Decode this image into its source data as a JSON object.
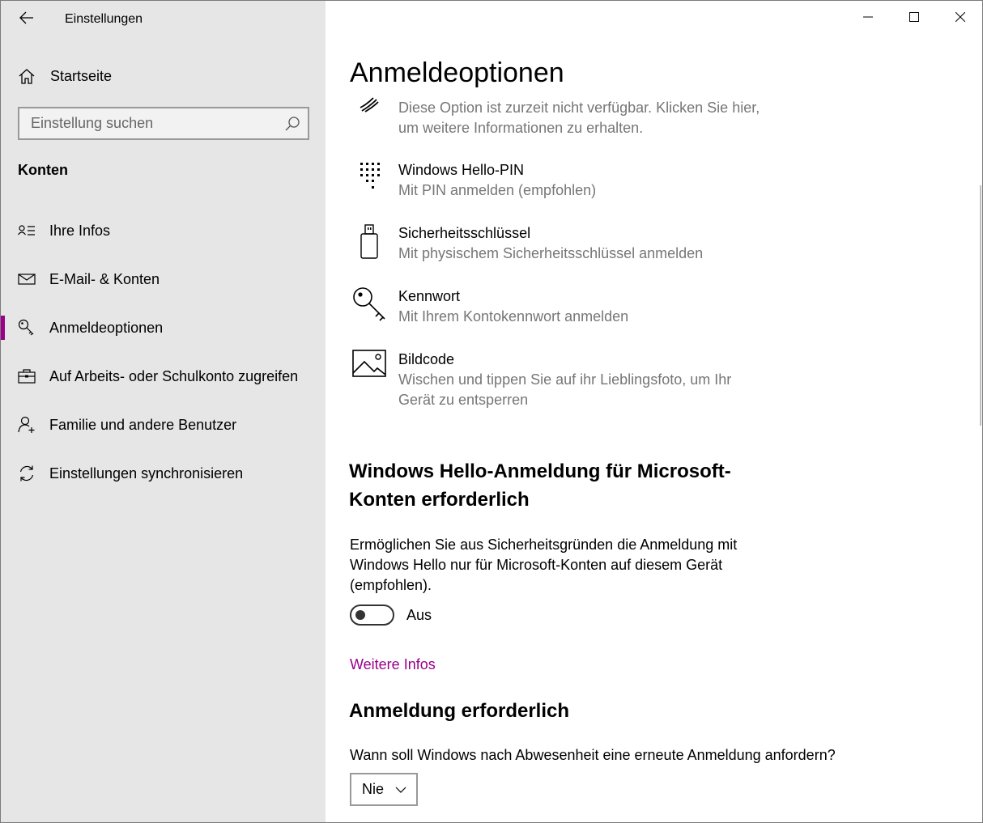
{
  "app": {
    "title": "Einstellungen"
  },
  "sidebar": {
    "home_label": "Startseite",
    "search_placeholder": "Einstellung suchen",
    "section_label": "Konten",
    "items": [
      {
        "label": "Ihre Infos",
        "icon": "person-card-icon",
        "active": false
      },
      {
        "label": "E-Mail- & Konten",
        "icon": "mail-icon",
        "active": false
      },
      {
        "label": "Anmeldeoptionen",
        "icon": "key-icon",
        "active": true
      },
      {
        "label": "Auf Arbeits- oder Schulkonto zugreifen",
        "icon": "briefcase-icon",
        "active": false
      },
      {
        "label": "Familie und andere Benutzer",
        "icon": "person-add-icon",
        "active": false
      },
      {
        "label": "Einstellungen synchronisieren",
        "icon": "sync-icon",
        "active": false
      }
    ],
    "accent_color": "#9a0089"
  },
  "main": {
    "title": "Anmeldeoptionen",
    "options": [
      {
        "title": "",
        "desc": "Diese Option ist zurzeit nicht verfügbar. Klicken Sie hier,\num weitere Informationen zu erhalten.",
        "icon": "fingerprint-icon"
      },
      {
        "title": "Windows Hello-PIN",
        "desc": "Mit PIN anmelden (empfohlen)",
        "icon": "pin-keypad-icon"
      },
      {
        "title": "Sicherheitsschlüssel",
        "desc": "Mit physischem Sicherheitsschlüssel anmelden",
        "icon": "usb-key-icon"
      },
      {
        "title": "Kennwort",
        "desc": "Mit Ihrem Kontokennwort anmelden",
        "icon": "key-icon"
      },
      {
        "title": "Bildcode",
        "desc": "Wischen und tippen Sie auf ihr Lieblingsfoto, um Ihr\nGerät zu entsperren",
        "icon": "picture-icon"
      }
    ],
    "hello_section": {
      "heading": "Windows Hello-Anmeldung für Microsoft-\nKonten erforderlich",
      "description": "Ermöglichen Sie aus Sicherheitsgründen die Anmeldung mit\nWindows Hello nur für Microsoft-Konten auf diesem Gerät\n(empfohlen).",
      "toggle_state": "Aus",
      "toggle_on": false,
      "link": "Weitere Infos"
    },
    "require_section": {
      "heading": "Anmeldung erforderlich",
      "question": "Wann soll Windows nach Abwesenheit eine erneute Anmeldung anfordern?",
      "dropdown_value": "Nie"
    }
  }
}
